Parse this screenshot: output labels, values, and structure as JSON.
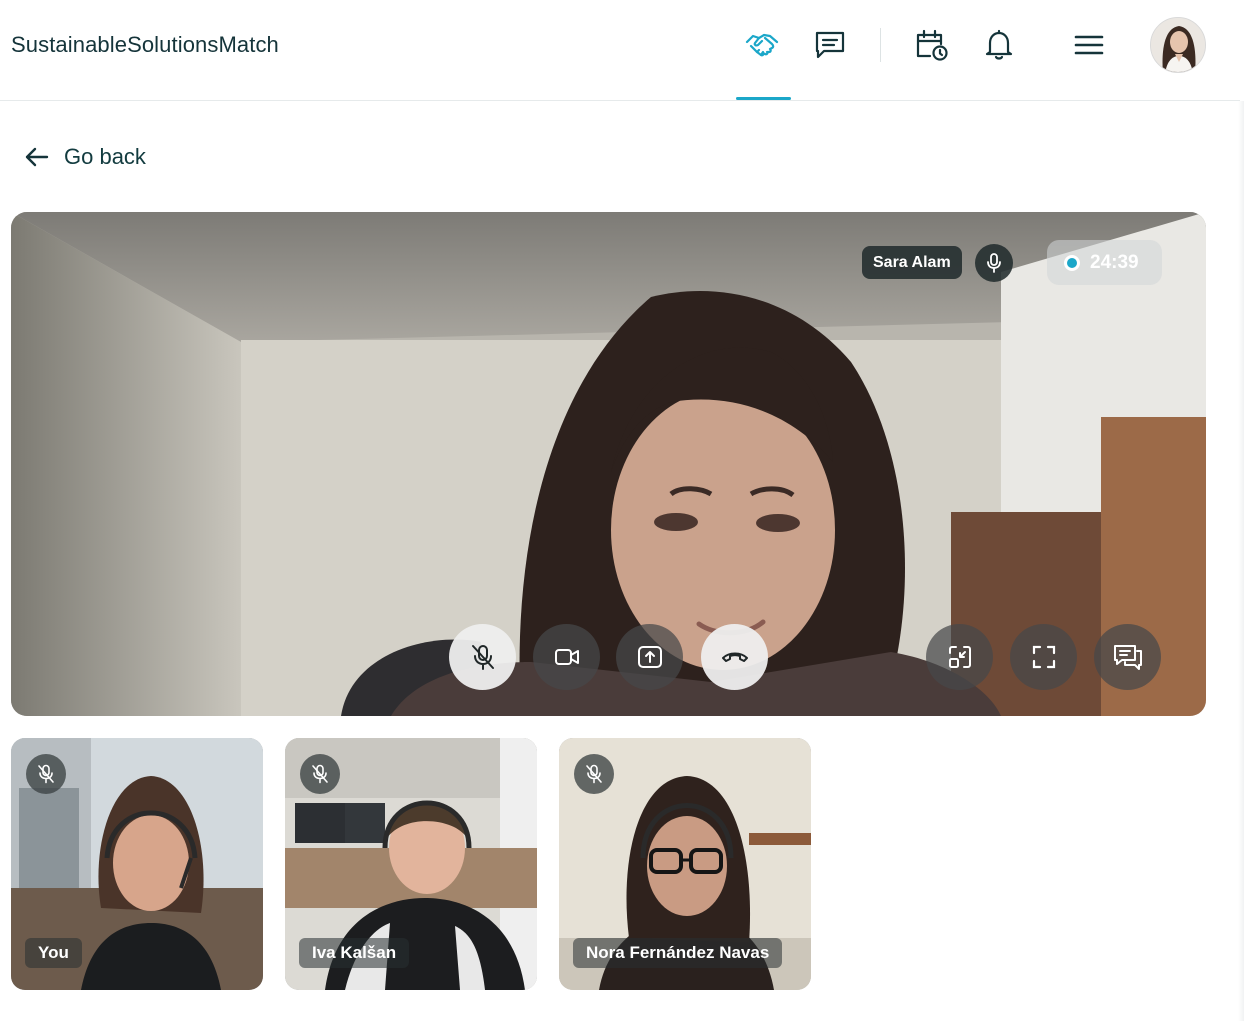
{
  "header": {
    "brand": "SustainableSolutionsMatch",
    "nav": [
      {
        "icon": "handshake-icon",
        "active": true
      },
      {
        "icon": "chat-icon"
      },
      {
        "icon": "calendar-clock-icon"
      },
      {
        "icon": "bell-icon"
      },
      {
        "icon": "menu-icon"
      }
    ],
    "accent_color": "#1ba7c9"
  },
  "back": {
    "label": "Go back"
  },
  "call": {
    "speaker": {
      "name": "Sara Alam",
      "mic_icon": "mic-icon"
    },
    "timer": "24:39",
    "controls": [
      "mic-off-icon",
      "video-icon",
      "screen-share-icon",
      "hang-up-icon",
      "minimize-icon",
      "fullscreen-icon",
      "chat-bubbles-icon"
    ],
    "participants": [
      {
        "label": "You",
        "muted": true
      },
      {
        "label": "Iva Kalšan",
        "muted": true
      },
      {
        "label": "Nora Fernández Navas",
        "muted": true
      }
    ]
  }
}
